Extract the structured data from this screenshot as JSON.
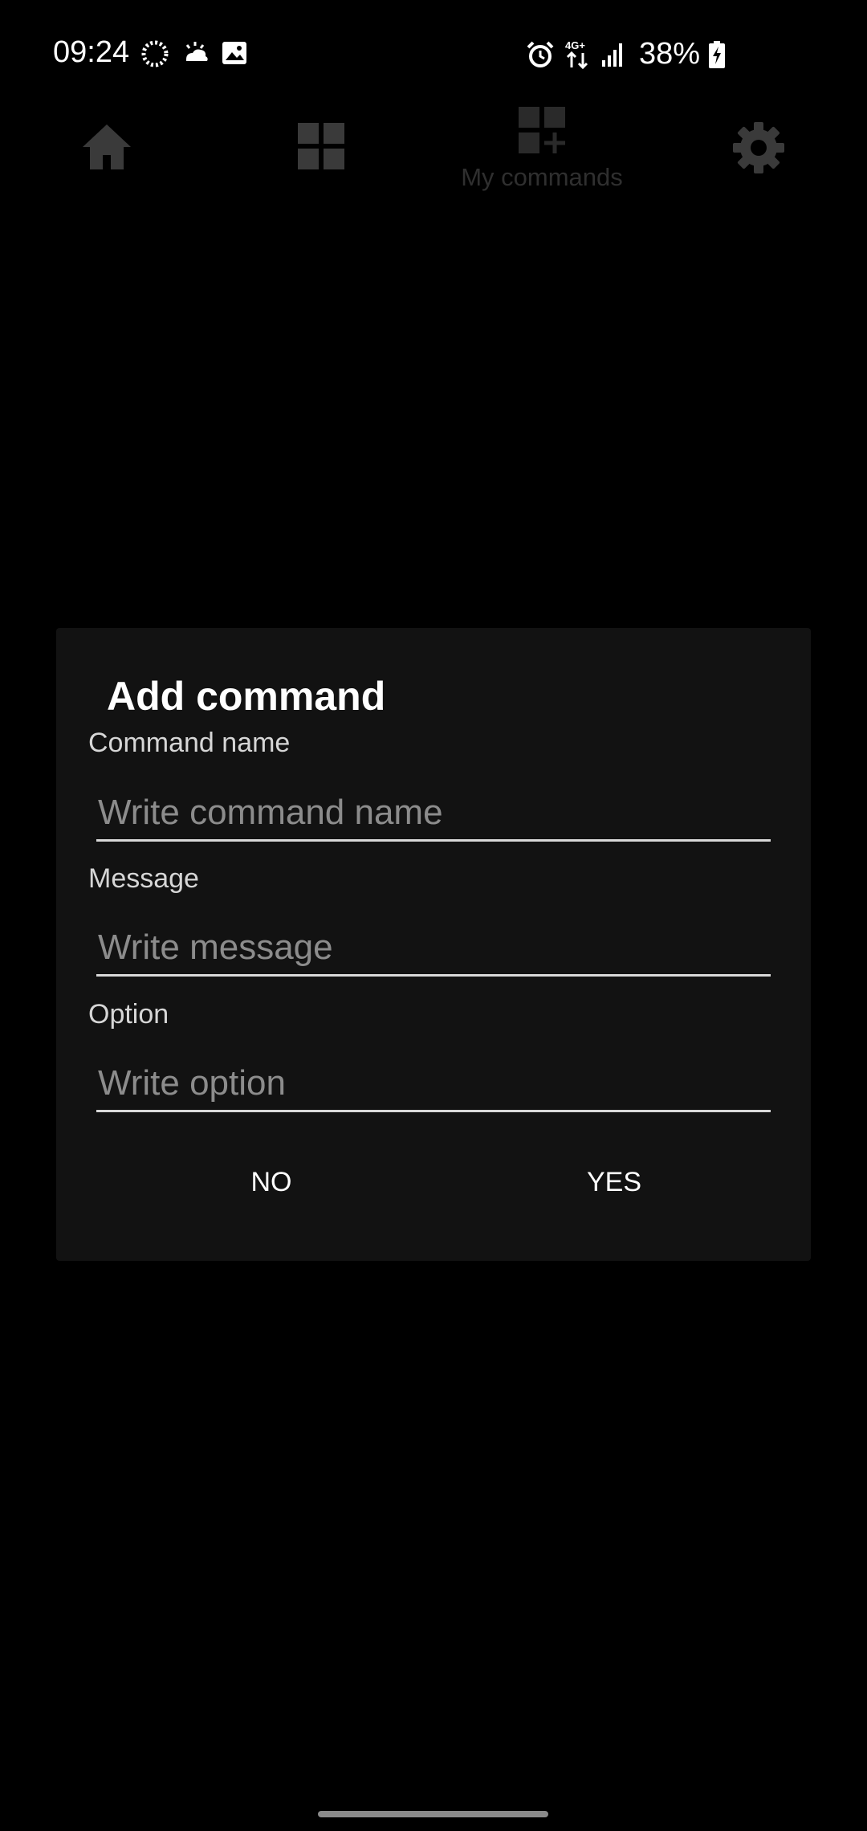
{
  "status_bar": {
    "time": "09:24",
    "network": "4G+",
    "battery": "38%",
    "icons": [
      "loading-ring-icon",
      "weather-icon",
      "image-icon",
      "alarm-icon",
      "data-arrows-icon",
      "signal-icon",
      "battery-charging-icon"
    ]
  },
  "nav": {
    "items": [
      {
        "icon": "home-icon",
        "label": ""
      },
      {
        "icon": "grid-icon",
        "label": ""
      },
      {
        "icon": "grid-add-icon",
        "label": "My commands"
      },
      {
        "icon": "gear-icon",
        "label": ""
      }
    ]
  },
  "dialog": {
    "title": "Add command",
    "fields": [
      {
        "label": "Command name",
        "placeholder": "Write command name",
        "value": ""
      },
      {
        "label": "Message",
        "placeholder": "Write message",
        "value": ""
      },
      {
        "label": "Option",
        "placeholder": "Write option",
        "value": ""
      }
    ],
    "buttons": {
      "no": "NO",
      "yes": "YES"
    }
  },
  "colors": {
    "background": "#000000",
    "dialog_bg": "#121212",
    "nav_icon": "#3a3a3a",
    "placeholder": "#8c8c8c",
    "underline": "#d8d8d8"
  }
}
